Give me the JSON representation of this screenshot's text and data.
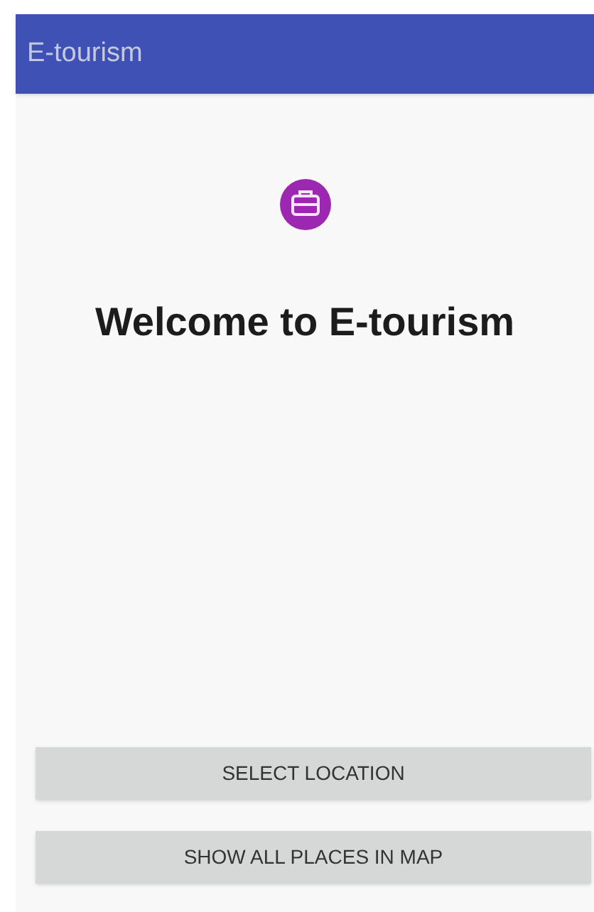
{
  "app_bar": {
    "title": "E-tourism"
  },
  "welcome": {
    "heading": "Welcome to E-tourism"
  },
  "buttons": [
    "SELECT LOCATION",
    "SHOW ALL PLACES IN MAP"
  ]
}
